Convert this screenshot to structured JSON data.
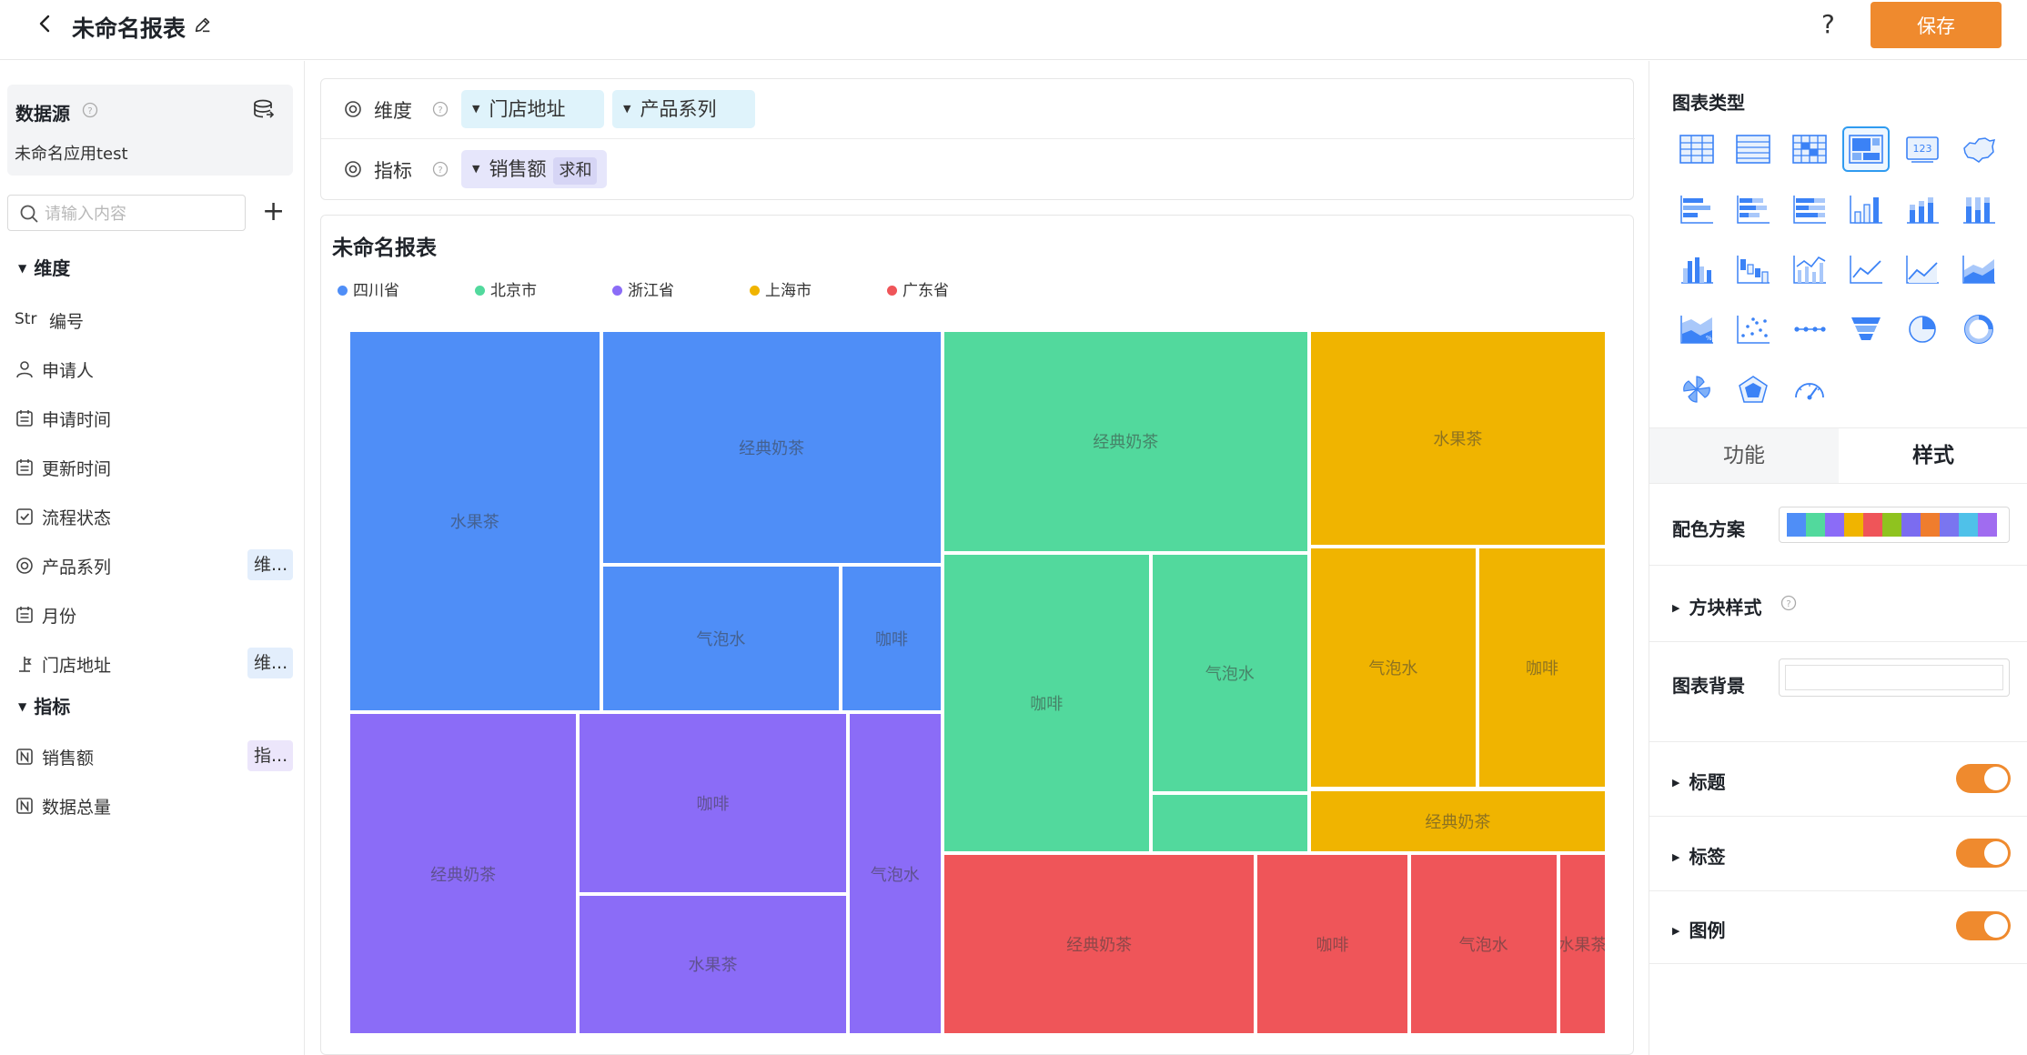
{
  "header": {
    "title": "未命名报表",
    "help_label": "?",
    "save_label": "保存"
  },
  "colors": {
    "accent": "#ef8a2e",
    "series": [
      "#4f8ef7",
      "#52d99d",
      "#8b6cf7",
      "#f0b400",
      "#ef5559"
    ]
  },
  "left": {
    "datasource_title": "数据源",
    "datasource_name": "未命名应用test",
    "search_placeholder": "请输入内容",
    "dimension_header": "维度",
    "measure_header": "指标",
    "dimensions": [
      {
        "label": "编号",
        "icon": "str-icon",
        "prefix": "Str",
        "tag": ""
      },
      {
        "label": "申请人",
        "icon": "user-icon",
        "tag": ""
      },
      {
        "label": "申请时间",
        "icon": "calendar-icon",
        "tag": ""
      },
      {
        "label": "更新时间",
        "icon": "calendar-icon",
        "tag": ""
      },
      {
        "label": "流程状态",
        "icon": "checkbox-icon",
        "tag": ""
      },
      {
        "label": "产品系列",
        "icon": "radio-icon",
        "tag": "维..."
      },
      {
        "label": "月份",
        "icon": "calendar-icon",
        "tag": ""
      },
      {
        "label": "门店地址",
        "icon": "location-icon",
        "tag": "维..."
      }
    ],
    "measures": [
      {
        "label": "销售额",
        "icon": "number-icon",
        "tag": "指..."
      },
      {
        "label": "数据总量",
        "icon": "number-icon",
        "tag": ""
      }
    ]
  },
  "config": {
    "dimension_label": "维度",
    "measure_label": "指标",
    "dimension_pills": [
      "门店地址",
      "产品系列"
    ],
    "measure_pill": "销售额",
    "measure_agg": "求和"
  },
  "chart": {
    "title": "未命名报表"
  },
  "chart_data": {
    "type": "treemap",
    "title": "未命名报表",
    "legend": [
      "四川省",
      "北京市",
      "浙江省",
      "上海市",
      "广东省"
    ],
    "legend_position": "top-left",
    "groups": [
      {
        "name": "四川省",
        "children": [
          {
            "name": "水果茶",
            "value": 14.2
          },
          {
            "name": "经典奶茶",
            "value": 11.8
          },
          {
            "name": "气泡水",
            "value": 5.2
          },
          {
            "name": "咖啡",
            "value": 2.2
          }
        ]
      },
      {
        "name": "北京市",
        "children": [
          {
            "name": "经典奶茶",
            "value": 12.0
          },
          {
            "name": "咖啡",
            "value": 9.2
          },
          {
            "name": "气泡水",
            "value": 5.6
          },
          {
            "name": "",
            "value": 1.4
          }
        ]
      },
      {
        "name": "浙江省",
        "children": [
          {
            "name": "经典奶茶",
            "value": 10.9
          },
          {
            "name": "咖啡",
            "value": 7.2
          },
          {
            "name": "水果茶",
            "value": 5.6
          },
          {
            "name": "气泡水",
            "value": 4.5
          }
        ]
      },
      {
        "name": "上海市",
        "children": [
          {
            "name": "水果茶",
            "value": 9.5
          },
          {
            "name": "气泡水",
            "value": 6.0
          },
          {
            "name": "咖啡",
            "value": 4.6
          },
          {
            "name": "经典奶茶",
            "value": 2.8
          }
        ]
      },
      {
        "name": "广东省",
        "children": [
          {
            "name": "经典奶茶",
            "value": 8.4
          },
          {
            "name": "气泡水",
            "value": 4.0
          },
          {
            "name": "咖啡",
            "value": 4.1
          },
          {
            "name": "水果茶",
            "value": 1.3
          }
        ]
      }
    ]
  },
  "right": {
    "chart_type_title": "图表类型",
    "tabs": [
      "功能",
      "样式"
    ],
    "palette_label": "配色方案",
    "palette": [
      "#4f8ef7",
      "#52d99d",
      "#8b6cf7",
      "#f0b400",
      "#ef5559",
      "#8fc31f",
      "#7b6cf0",
      "#ef7d2e",
      "#7a75f0",
      "#4fc1e9",
      "#a06cf0"
    ],
    "block_style_label": "方块样式",
    "bg_label": "图表背景",
    "title_label": "标题",
    "label_label": "标签",
    "legend_label": "图例"
  }
}
